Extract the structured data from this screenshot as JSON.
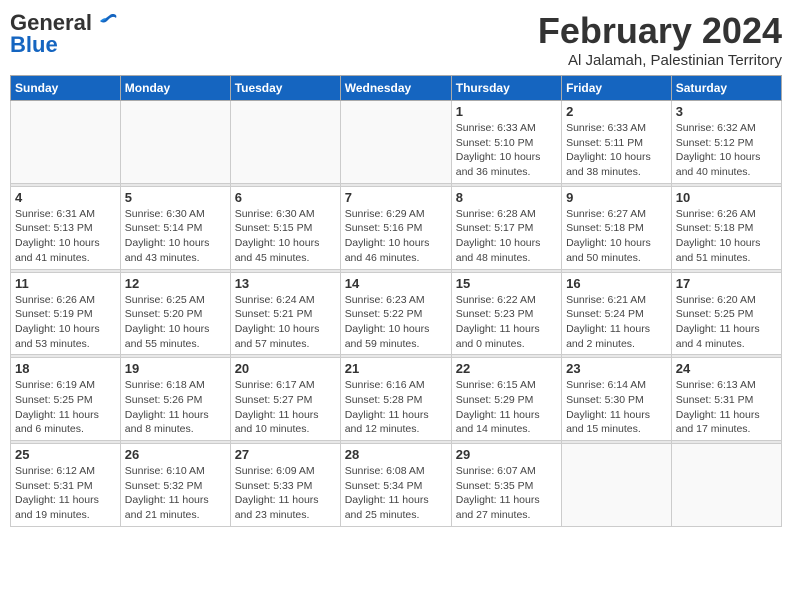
{
  "logo": {
    "general": "General",
    "blue": "Blue"
  },
  "header": {
    "month_year": "February 2024",
    "location": "Al Jalamah, Palestinian Territory"
  },
  "days_of_week": [
    "Sunday",
    "Monday",
    "Tuesday",
    "Wednesday",
    "Thursday",
    "Friday",
    "Saturday"
  ],
  "weeks": [
    [
      {
        "day": "",
        "info": ""
      },
      {
        "day": "",
        "info": ""
      },
      {
        "day": "",
        "info": ""
      },
      {
        "day": "",
        "info": ""
      },
      {
        "day": "1",
        "info": "Sunrise: 6:33 AM\nSunset: 5:10 PM\nDaylight: 10 hours\nand 36 minutes."
      },
      {
        "day": "2",
        "info": "Sunrise: 6:33 AM\nSunset: 5:11 PM\nDaylight: 10 hours\nand 38 minutes."
      },
      {
        "day": "3",
        "info": "Sunrise: 6:32 AM\nSunset: 5:12 PM\nDaylight: 10 hours\nand 40 minutes."
      }
    ],
    [
      {
        "day": "4",
        "info": "Sunrise: 6:31 AM\nSunset: 5:13 PM\nDaylight: 10 hours\nand 41 minutes."
      },
      {
        "day": "5",
        "info": "Sunrise: 6:30 AM\nSunset: 5:14 PM\nDaylight: 10 hours\nand 43 minutes."
      },
      {
        "day": "6",
        "info": "Sunrise: 6:30 AM\nSunset: 5:15 PM\nDaylight: 10 hours\nand 45 minutes."
      },
      {
        "day": "7",
        "info": "Sunrise: 6:29 AM\nSunset: 5:16 PM\nDaylight: 10 hours\nand 46 minutes."
      },
      {
        "day": "8",
        "info": "Sunrise: 6:28 AM\nSunset: 5:17 PM\nDaylight: 10 hours\nand 48 minutes."
      },
      {
        "day": "9",
        "info": "Sunrise: 6:27 AM\nSunset: 5:18 PM\nDaylight: 10 hours\nand 50 minutes."
      },
      {
        "day": "10",
        "info": "Sunrise: 6:26 AM\nSunset: 5:18 PM\nDaylight: 10 hours\nand 51 minutes."
      }
    ],
    [
      {
        "day": "11",
        "info": "Sunrise: 6:26 AM\nSunset: 5:19 PM\nDaylight: 10 hours\nand 53 minutes."
      },
      {
        "day": "12",
        "info": "Sunrise: 6:25 AM\nSunset: 5:20 PM\nDaylight: 10 hours\nand 55 minutes."
      },
      {
        "day": "13",
        "info": "Sunrise: 6:24 AM\nSunset: 5:21 PM\nDaylight: 10 hours\nand 57 minutes."
      },
      {
        "day": "14",
        "info": "Sunrise: 6:23 AM\nSunset: 5:22 PM\nDaylight: 10 hours\nand 59 minutes."
      },
      {
        "day": "15",
        "info": "Sunrise: 6:22 AM\nSunset: 5:23 PM\nDaylight: 11 hours\nand 0 minutes."
      },
      {
        "day": "16",
        "info": "Sunrise: 6:21 AM\nSunset: 5:24 PM\nDaylight: 11 hours\nand 2 minutes."
      },
      {
        "day": "17",
        "info": "Sunrise: 6:20 AM\nSunset: 5:25 PM\nDaylight: 11 hours\nand 4 minutes."
      }
    ],
    [
      {
        "day": "18",
        "info": "Sunrise: 6:19 AM\nSunset: 5:25 PM\nDaylight: 11 hours\nand 6 minutes."
      },
      {
        "day": "19",
        "info": "Sunrise: 6:18 AM\nSunset: 5:26 PM\nDaylight: 11 hours\nand 8 minutes."
      },
      {
        "day": "20",
        "info": "Sunrise: 6:17 AM\nSunset: 5:27 PM\nDaylight: 11 hours\nand 10 minutes."
      },
      {
        "day": "21",
        "info": "Sunrise: 6:16 AM\nSunset: 5:28 PM\nDaylight: 11 hours\nand 12 minutes."
      },
      {
        "day": "22",
        "info": "Sunrise: 6:15 AM\nSunset: 5:29 PM\nDaylight: 11 hours\nand 14 minutes."
      },
      {
        "day": "23",
        "info": "Sunrise: 6:14 AM\nSunset: 5:30 PM\nDaylight: 11 hours\nand 15 minutes."
      },
      {
        "day": "24",
        "info": "Sunrise: 6:13 AM\nSunset: 5:31 PM\nDaylight: 11 hours\nand 17 minutes."
      }
    ],
    [
      {
        "day": "25",
        "info": "Sunrise: 6:12 AM\nSunset: 5:31 PM\nDaylight: 11 hours\nand 19 minutes."
      },
      {
        "day": "26",
        "info": "Sunrise: 6:10 AM\nSunset: 5:32 PM\nDaylight: 11 hours\nand 21 minutes."
      },
      {
        "day": "27",
        "info": "Sunrise: 6:09 AM\nSunset: 5:33 PM\nDaylight: 11 hours\nand 23 minutes."
      },
      {
        "day": "28",
        "info": "Sunrise: 6:08 AM\nSunset: 5:34 PM\nDaylight: 11 hours\nand 25 minutes."
      },
      {
        "day": "29",
        "info": "Sunrise: 6:07 AM\nSunset: 5:35 PM\nDaylight: 11 hours\nand 27 minutes."
      },
      {
        "day": "",
        "info": ""
      },
      {
        "day": "",
        "info": ""
      }
    ]
  ]
}
